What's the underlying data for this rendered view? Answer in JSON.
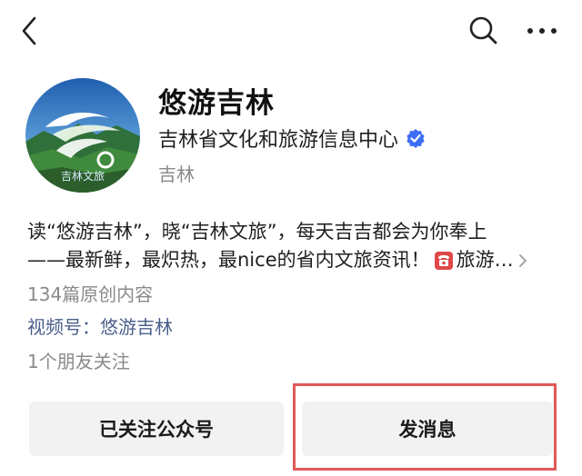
{
  "nav": {
    "back_icon": "back-chevron-icon",
    "search_icon": "search-icon",
    "more_icon": "more-dots-icon"
  },
  "profile": {
    "name": "悠游吉林",
    "organization": "吉林省文化和旅游信息中心",
    "verified_color": "#3d6ef5",
    "region": "吉林",
    "avatar_caption": "吉林文旅"
  },
  "description": {
    "line1": "读“悠游吉林”，晓“吉林文旅”，每天吉吉都会为你奉上",
    "line2": "——最新鲜，最炽热，最nice的省内文旅资讯！",
    "line2_tail": "旅游…",
    "phone_icon": "telephone-icon",
    "expand_icon": "chevron-right-icon"
  },
  "stats": {
    "original_count": "134篇原创内容",
    "video_account": "视频号：悠游吉林",
    "friends_following": "1个朋友关注"
  },
  "actions": {
    "follow_label": "已关注公众号",
    "message_label": "发消息"
  },
  "colors": {
    "accent_link": "#4a5f8a",
    "highlight_border": "#e05a58",
    "button_bg": "#f2f2f2"
  }
}
